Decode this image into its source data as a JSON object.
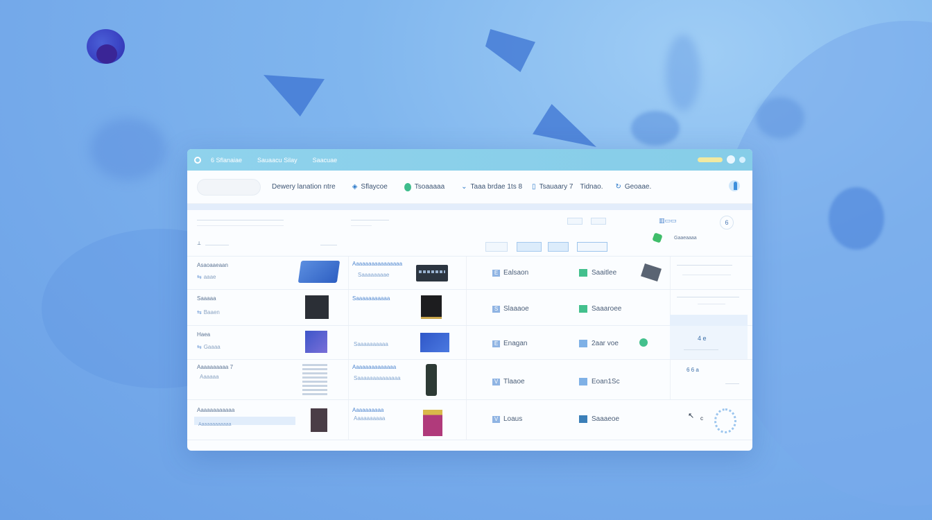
{
  "titlebar": {
    "tabs": [
      "6 Sflanaiae",
      "Sauaacu Silay",
      "Saacuae"
    ]
  },
  "toolbar": {
    "search_placeholder": "",
    "items": [
      {
        "label": "Dewery lanation ntre",
        "icon": ""
      },
      {
        "label": "Sflaycoe",
        "icon": "pin-icon"
      },
      {
        "label": "Tsoaaaaa",
        "icon": "leaf-icon"
      },
      {
        "label": "Taaa brdae 1ts 8",
        "icon": "chevron-icon"
      },
      {
        "label": "Tsauaary 7",
        "icon": "bag-icon"
      },
      {
        "label": "Tidnao.",
        "icon": ""
      },
      {
        "label": "Geoaae.",
        "icon": "refresh-icon"
      }
    ]
  },
  "filters": {
    "label_a": "",
    "label_b": "",
    "boxes": [
      "",
      "",
      ""
    ],
    "right_label": "Gaaeaaaa",
    "circle": "6"
  },
  "rows": [
    {
      "name": "Asaoaaeaan",
      "sub": "aaae",
      "link": "Aaaaaaaaaaaaaaaa",
      "link2": "Saaaaaaaae",
      "status": "Ealsaon",
      "status_icon": "E",
      "tag": "Saaitlee",
      "tag_style": "green"
    },
    {
      "name": "Saaaaa",
      "sub": "Baaen",
      "link": "Saaaaaaaaaaa",
      "link2": "",
      "status": "Slaaaoe",
      "status_icon": "S",
      "tag": "Saaaroee",
      "tag_style": "green"
    },
    {
      "name": "Haea",
      "sub": "Gaaaa",
      "link": "",
      "link2": "Saaaaaaaaaa",
      "status": "Enagan",
      "status_icon": "E",
      "tag": "2aar voe",
      "tag_style": "blue"
    },
    {
      "name": "Aaaaaaaaaa 7",
      "sub": "Aaaaaa",
      "link": "Aaaaaaaaaaaaaa",
      "link2": "Saaaaaaaaaaaaaa",
      "status": "Tlaaoe",
      "status_icon": "V",
      "tag": "Eoan1Sc",
      "tag_style": "blue"
    },
    {
      "name": "Aaaaaaaaaaaa",
      "sub": "Aaaaaaaaaaaa",
      "link": "Aaaaaaaaaa",
      "link2": "Aaaaaaaaaa",
      "status": "Loaus",
      "status_icon": "V",
      "tag": "Saaaeoe",
      "tag_style": "dark"
    }
  ],
  "side_panel": [
    "4 e",
    "6 6 a",
    ""
  ]
}
